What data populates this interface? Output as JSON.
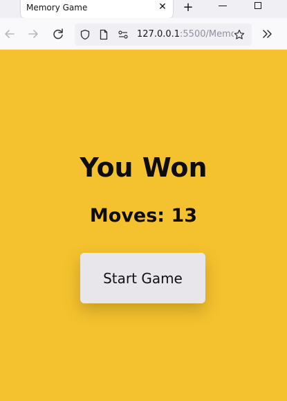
{
  "browser": {
    "tab_title": "Memory Game",
    "tab_close_icon": "close-icon",
    "new_tab_icon": "plus-icon",
    "window_controls": [
      "minimize-icon",
      "maximize-icon"
    ],
    "url_host": "127.0.0.1",
    "url_rest": ":5500/Memo",
    "nav_icons": [
      "back-arrow-icon",
      "forward-arrow-icon",
      "reload-icon"
    ],
    "url_icons": [
      "shield-icon",
      "page-icon",
      "permissions-icon",
      "star-icon"
    ],
    "overflow_icon": "chevron-double-right-icon"
  },
  "game": {
    "title": "You Won",
    "moves_label": "Moves: 13",
    "start_button_label": "Start Game",
    "background_color": "#f4c22e"
  }
}
